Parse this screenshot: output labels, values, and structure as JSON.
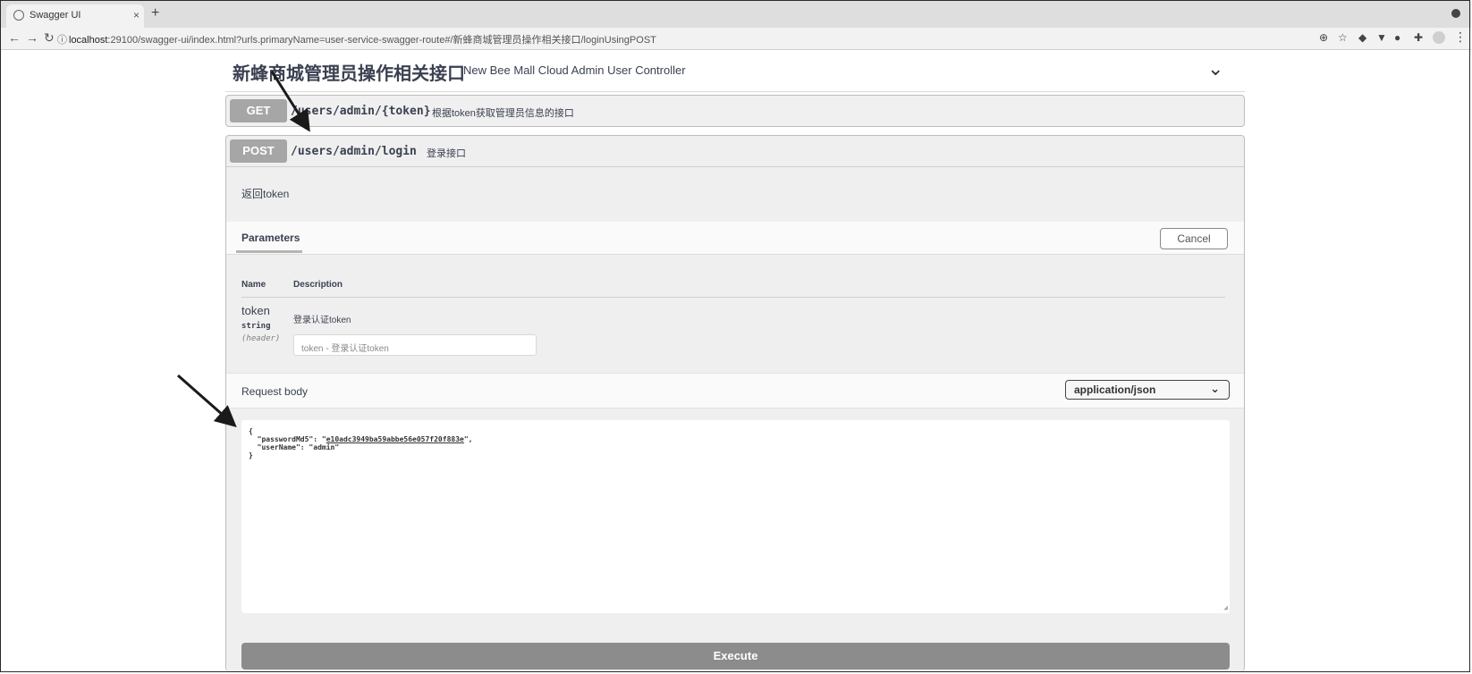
{
  "browser": {
    "tab_title": "Swagger UI",
    "tab_close": "×",
    "new_tab": "+",
    "url_host": "localhost",
    "url_rest": ":29100/swagger-ui/index.html?urls.primaryName=user-service-swagger-route#/新蜂商城管理员操作相关接口/loginUsingPOST"
  },
  "section": {
    "title": "新蜂商城管理员操作相关接口",
    "subtitle": "New Bee Mall Cloud Admin User Controller"
  },
  "operations": [
    {
      "method": "GET",
      "path": "/users/admin/{token}",
      "summary": "根据token获取管理员信息的接口"
    },
    {
      "method": "POST",
      "path": "/users/admin/login",
      "summary": "登录接口"
    }
  ],
  "post_detail": {
    "description": "返回token",
    "parameters_tab": "Parameters",
    "cancel_label": "Cancel",
    "col_name": "Name",
    "col_description": "Description",
    "param": {
      "name": "token",
      "type": "string",
      "in": "(header)",
      "description": "登录认证token",
      "placeholder": "token - 登录认证token"
    },
    "request_body_label": "Request body",
    "content_type": "application/json",
    "body_lines": {
      "open": "{",
      "pw_key": "  \"passwordMd5\": \"",
      "pw_value": "e10adc3949ba59abbe56e057f20f883e",
      "pw_end": "\",",
      "user": "  \"userName\": \"admin\"",
      "close": "}"
    },
    "execute_label": "Execute"
  },
  "icons": [
    "globe-icon",
    "back-icon",
    "forward-icon",
    "reload-icon",
    "info-icon",
    "zoom-icon",
    "star-icon",
    "chevron-down-icon",
    "arrow-annotation"
  ]
}
